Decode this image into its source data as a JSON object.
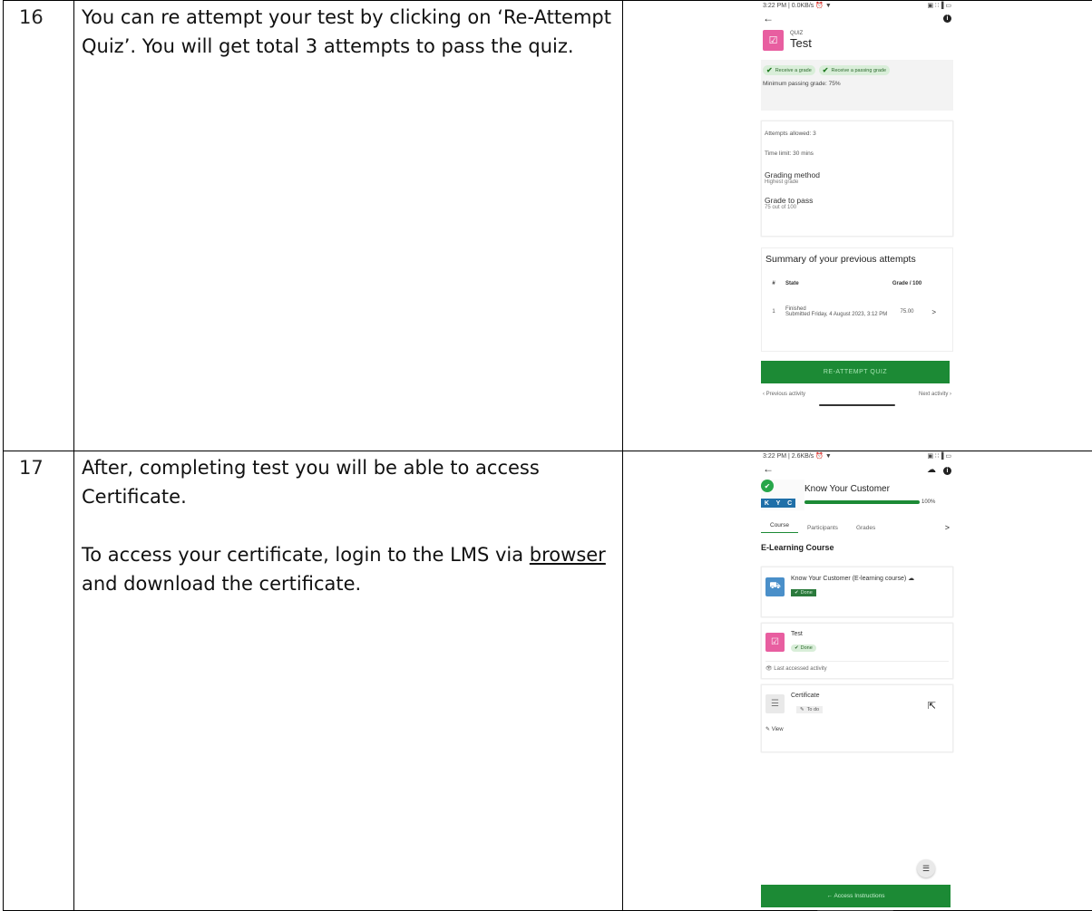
{
  "rows": [
    {
      "number": "16",
      "text": "You can re attempt your test by clicking on ‘Re-Attempt Quiz’. You will get total 3 attempts to pass the quiz."
    },
    {
      "number": "17",
      "text1": "After, completing test you will be able to access Certificate.",
      "text2_before": "To access your certificate, login to the LMS via ",
      "text2_link": "browser",
      "text2_after": " and download the certificate."
    }
  ],
  "screen1": {
    "status_left": "3:22 PM | 0.0KB/s ⏰ ▼",
    "status_right": "▣ ∷▐ ▭",
    "back": "←",
    "info": "i",
    "kicker": "QUIZ",
    "title": "Test",
    "pill1": "Receive a grade",
    "pill2": "Receive a passing grade",
    "min_grade": "Minimum passing grade: 75%",
    "attempts": "Attempts allowed: 3",
    "time_limit": "Time limit: 30 mins",
    "grading_label": "Grading method",
    "grading_value": "Highest grade",
    "pass_label": "Grade to pass",
    "pass_value": "75 out of 100",
    "summary_title": "Summary of your previous attempts",
    "col_num": "#",
    "col_state": "State",
    "col_grade": "Grade / 100",
    "row_num": "1",
    "row_state1": "Finished",
    "row_state2": "Submitted Friday, 4 August 2023, 3:12 PM",
    "row_grade": "75.00",
    "row_chevron": ">",
    "reattempt": "RE-ATTEMPT QUIZ",
    "prev": "‹ Previous activity",
    "next": "Next activity ›"
  },
  "screen2": {
    "status_left": "3:22 PM | 2.6KB/s ⏰ ▼",
    "status_right": "▣ ∷▐ ▭",
    "back": "←",
    "cloud": "☁",
    "info": "i",
    "kyc_letters": [
      "K",
      "Y",
      "C"
    ],
    "course_title": "Know Your Customer",
    "progress": 100,
    "progress_label": "100%",
    "tabs": [
      "Course",
      "Participants",
      "Grades"
    ],
    "tab_more": ">",
    "section": "E-Learning Course",
    "act1_name": "Know Your Customer (E-learning course) ☁",
    "act1_status": "Done",
    "act2_name": "Test",
    "act2_status": "Done",
    "last_accessed": "👁 Last accessed activity",
    "act3_name": "Certificate",
    "act3_status": "To do",
    "view": "View",
    "access_btn": "← Access Instructions",
    "fab": "☰"
  }
}
